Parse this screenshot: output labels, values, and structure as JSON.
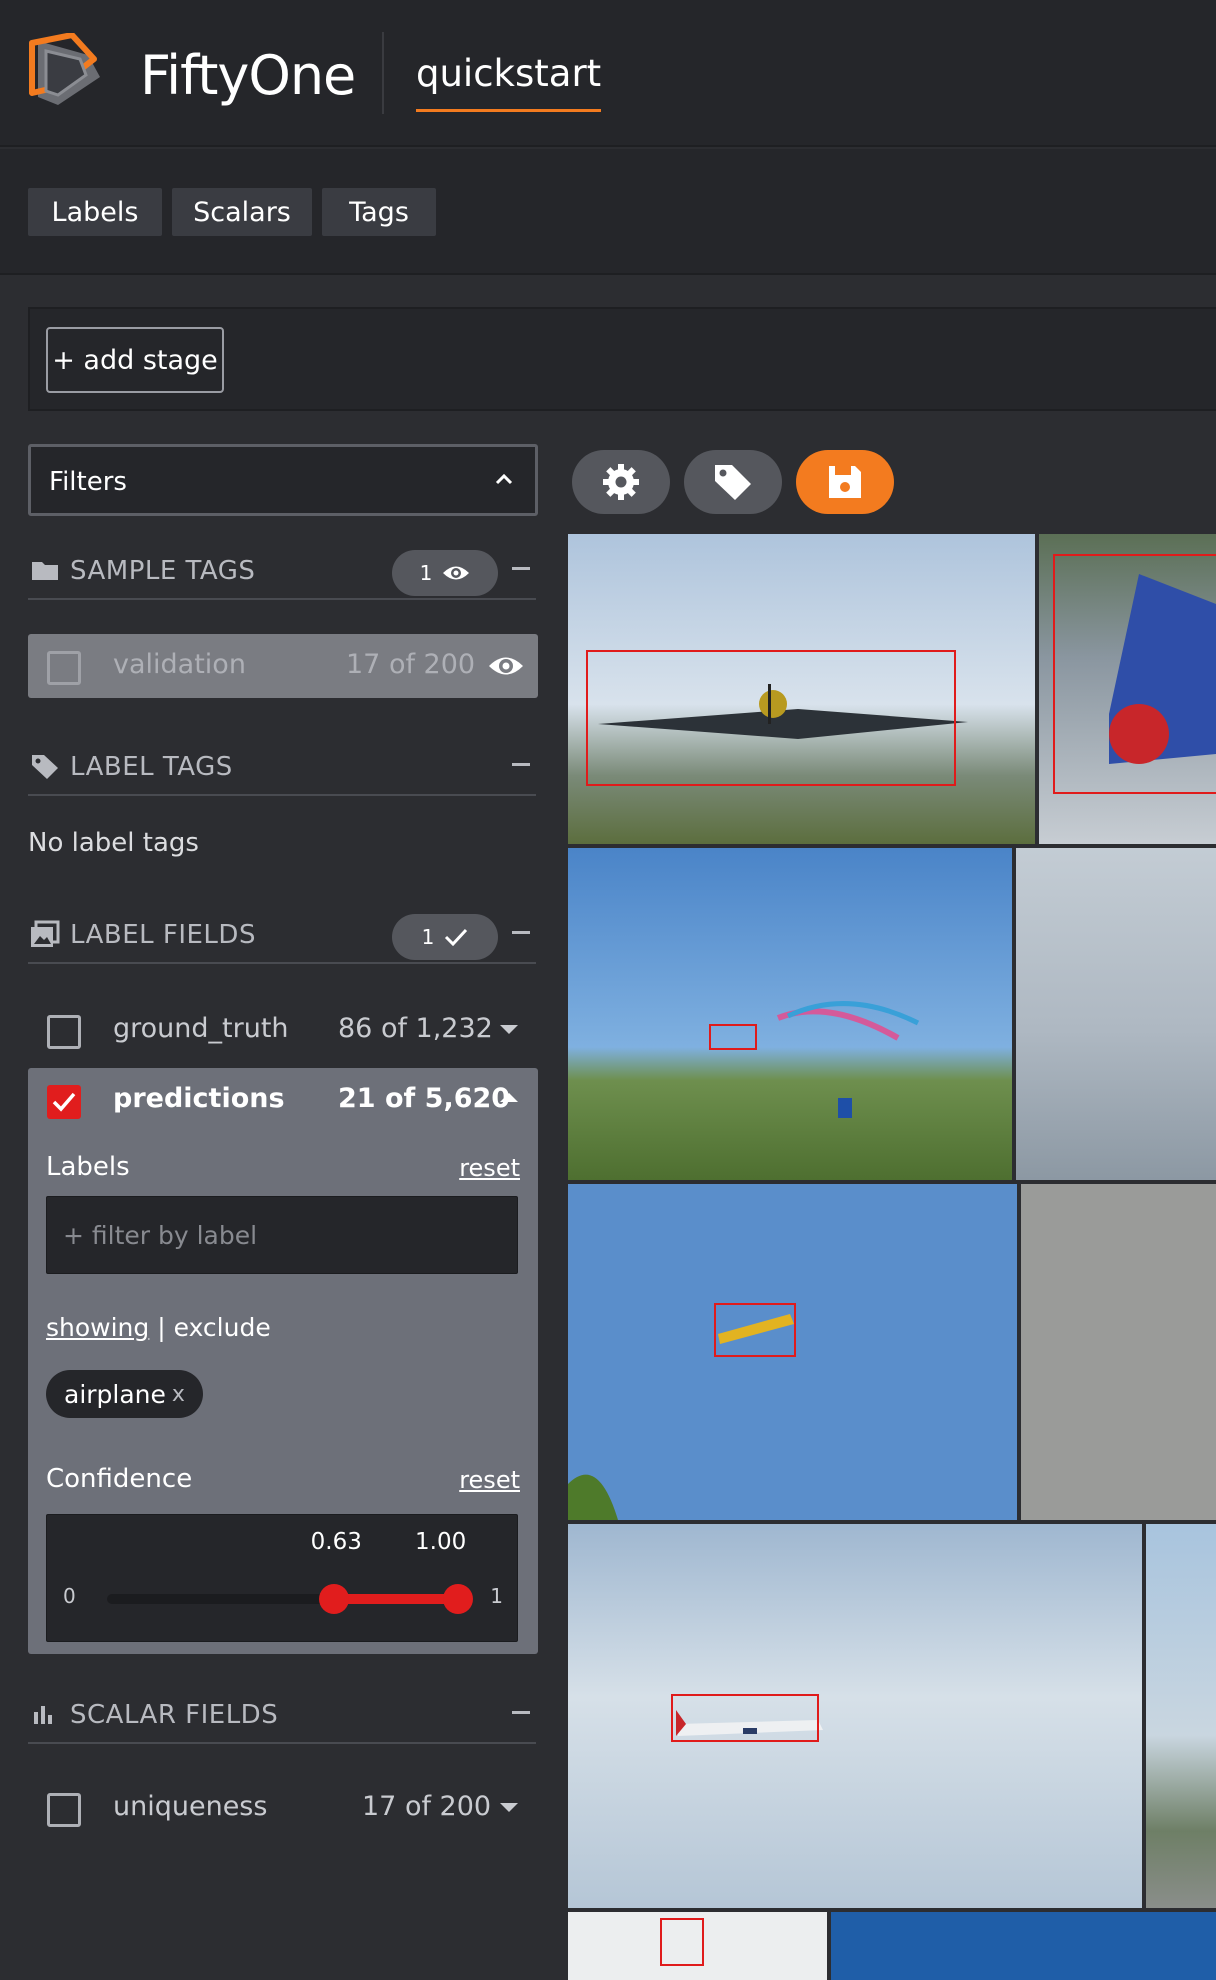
{
  "header": {
    "brand": "FiftyOne",
    "dataset": "quickstart"
  },
  "tabs": [
    "Labels",
    "Scalars",
    "Tags"
  ],
  "stage": {
    "add_label": "+ add stage"
  },
  "sidebar": {
    "filters_title": "Filters",
    "sample_tags": {
      "title": "SAMPLE TAGS",
      "pill_count": "1",
      "items": [
        {
          "name": "validation",
          "count": "17 of 200"
        }
      ]
    },
    "label_tags": {
      "title": "LABEL TAGS",
      "empty": "No label tags"
    },
    "label_fields": {
      "title": "LABEL FIELDS",
      "pill_count": "1",
      "ground_truth": {
        "name": "ground_truth",
        "count": "86 of 1,232"
      },
      "predictions": {
        "name": "predictions",
        "count": "21 of 5,620",
        "labels_title": "Labels",
        "reset": "reset",
        "filter_placeholder": "+ filter by label",
        "showing": "showing",
        "separator": "|",
        "exclude": "exclude",
        "chip": "airplane",
        "chip_x": "x",
        "confidence_title": "Confidence",
        "confidence": {
          "low": "0.63",
          "high": "1.00",
          "min": "0",
          "max": "1",
          "low_value": 0.63,
          "high_value": 1.0
        }
      }
    },
    "scalar_fields": {
      "title": "SCALAR FIELDS",
      "items": [
        {
          "name": "uniqueness",
          "count": "17 of 200"
        }
      ]
    }
  },
  "toolbar": [
    "gear-icon",
    "tag-icon",
    "save-icon"
  ],
  "colors": {
    "accent": "#f37b1f",
    "label_red": "#e11d1d",
    "bg": "#2c2d31",
    "panel": "#25262a"
  }
}
